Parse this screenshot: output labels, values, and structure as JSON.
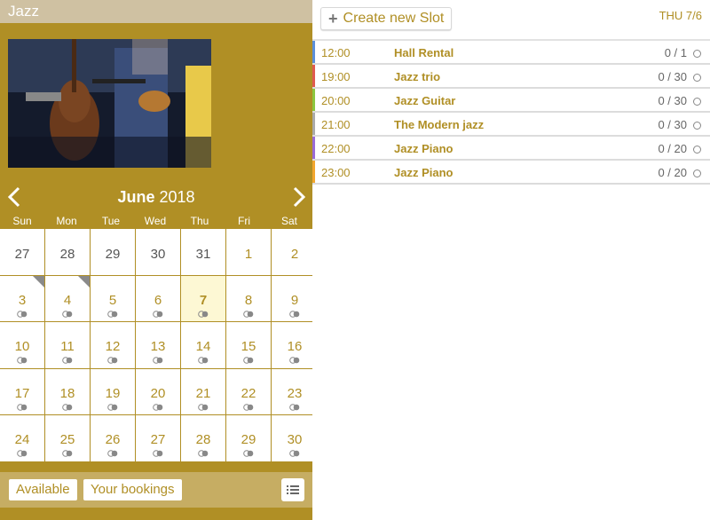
{
  "app": {
    "title": "Jazz"
  },
  "calendar": {
    "month": "June",
    "year": "2018",
    "weekdays": [
      "Sun",
      "Mon",
      "Tue",
      "Wed",
      "Thu",
      "Fri",
      "Sat"
    ],
    "weeks": [
      [
        "27",
        "28",
        "29",
        "30",
        "31",
        "1",
        "2"
      ],
      [
        "3",
        "4",
        "5",
        "6",
        "7",
        "8",
        "9"
      ],
      [
        "10",
        "11",
        "12",
        "13",
        "14",
        "15",
        "16"
      ],
      [
        "17",
        "18",
        "19",
        "20",
        "21",
        "22",
        "23"
      ],
      [
        "24",
        "25",
        "26",
        "27",
        "28",
        "29",
        "30"
      ]
    ],
    "today": "7"
  },
  "footer": {
    "available_label": "Available",
    "bookings_label": "Your bookings"
  },
  "schedule": {
    "create_label": "Create new Slot",
    "date_label": "THU 7/6",
    "slots": [
      {
        "time": "12:00",
        "name": "Hall Rental",
        "count": "0 / 1",
        "color": "#5b8fd9"
      },
      {
        "time": "19:00",
        "name": "Jazz trio",
        "count": "0 / 30",
        "color": "#e05a4f"
      },
      {
        "time": "20:00",
        "name": "Jazz Guitar",
        "count": "0 / 30",
        "color": "#8cc63f"
      },
      {
        "time": "21:00",
        "name": "The Modern jazz",
        "count": "0 / 30",
        "color": "#aaaaaa"
      },
      {
        "time": "22:00",
        "name": "Jazz Piano",
        "count": "0 / 20",
        "color": "#9a6bd6"
      },
      {
        "time": "23:00",
        "name": "Jazz Piano",
        "count": "0 / 20",
        "color": "#f2a62e"
      }
    ]
  },
  "colors": {
    "accent": "#b08f25",
    "header": "#cfc1a2",
    "today_bg": "#fdf8d4"
  }
}
